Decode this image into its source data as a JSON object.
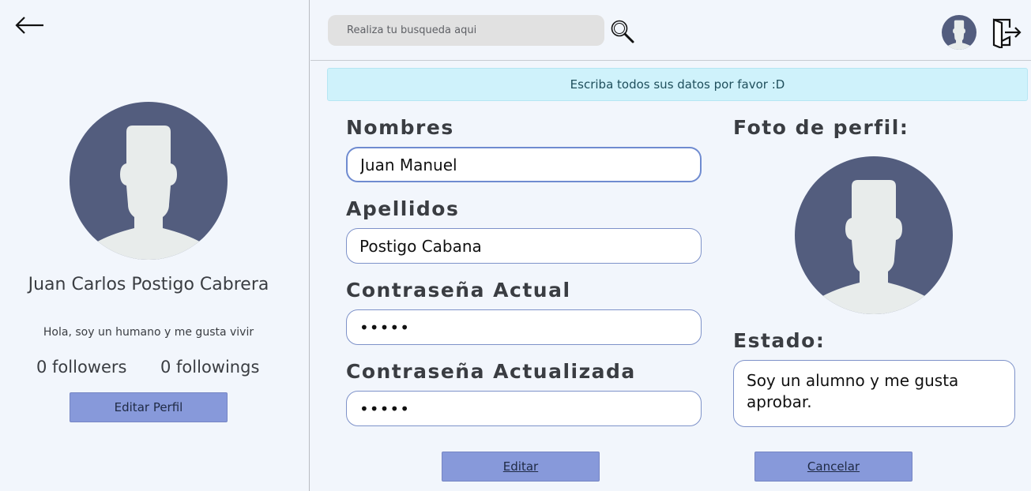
{
  "sidebar": {
    "back_icon": "arrow-left-icon",
    "user_name": "Juan Carlos Postigo Cabrera",
    "bio": "Hola, soy un humano y me gusta vivir",
    "followers": "0 followers",
    "followings": "0 followings",
    "edit_profile_label": "Editar Perfil"
  },
  "topbar": {
    "search_placeholder": "Realiza tu busqueda aqui",
    "search_icon": "search-icon",
    "avatar_icon": "avatar-icon",
    "logout_icon": "logout-icon"
  },
  "alert": {
    "message": "Escriba todos sus datos por favor :D"
  },
  "form": {
    "nombres_label": "Nombres",
    "nombres_value": "Juan Manuel",
    "apellidos_label": "Apellidos",
    "apellidos_value": "Postigo Cabana",
    "password_actual_label": "Contraseña Actual",
    "password_actual_value": "•••••",
    "password_nueva_label": "Contraseña Actualizada",
    "password_nueva_value": "•••••",
    "foto_label": "Foto de perfil:",
    "estado_label": "Estado:",
    "estado_value": "Soy un alumno y me gusta aprobar.",
    "editar_label": "Editar",
    "cancelar_label": "Cancelar"
  },
  "colors": {
    "background": "#f2f6fc",
    "button": "#8799da",
    "alert_bg": "#cff2fb",
    "avatar_bg": "#535d7e",
    "avatar_figure": "#e8eceb"
  }
}
